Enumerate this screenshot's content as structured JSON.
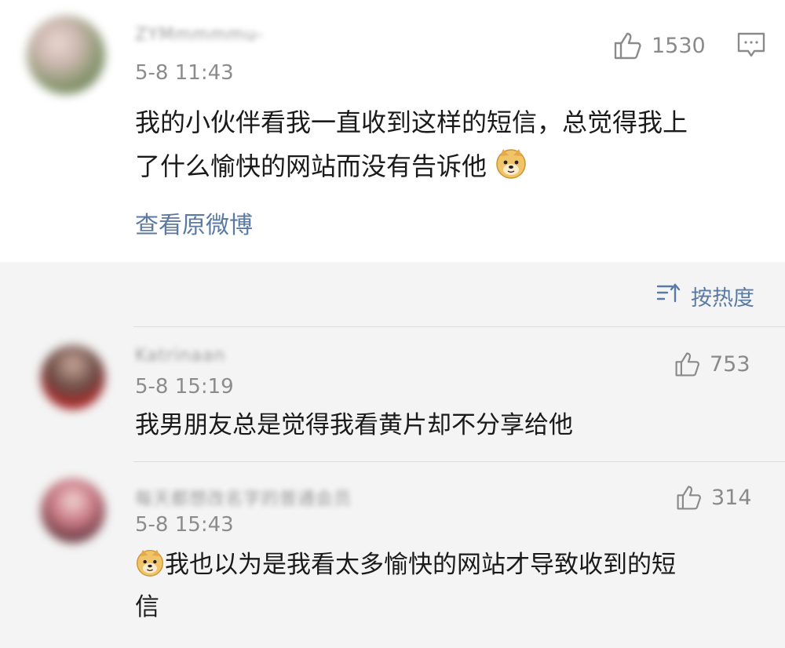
{
  "main_comment": {
    "username": "ZYMmmmmu-",
    "timestamp": "5-8 11:43",
    "likes": "1530",
    "text_line1": "我的小伙伴看我一直收到这样的短信，总觉得我上",
    "text_line2": "了什么愉快的网站而没有告诉他",
    "view_original": "查看原微博",
    "icons": [
      "thumbs-up-icon",
      "reply-comment-icon",
      "doge-emoji-icon"
    ]
  },
  "sort": {
    "label": "按热度",
    "icon": "sort-icon"
  },
  "replies": [
    {
      "username": "Katrinaan",
      "timestamp": "5-8 15:19",
      "likes": "753",
      "text_line1": "我男朋友总是觉得我看黄片却不分享给他",
      "text_line2": ""
    },
    {
      "username": "每天都想改名字的普通会员",
      "timestamp": "5-8 15:43",
      "likes": "314",
      "text_line1": "我也以为是我看太多愉快的网站才导致收到的短",
      "text_line2": "信"
    }
  ],
  "colors": {
    "link": "#5b7aa3",
    "text": "#1a1a1a",
    "muted": "#8c8c8c",
    "page_bg": "#f4f4f4"
  }
}
